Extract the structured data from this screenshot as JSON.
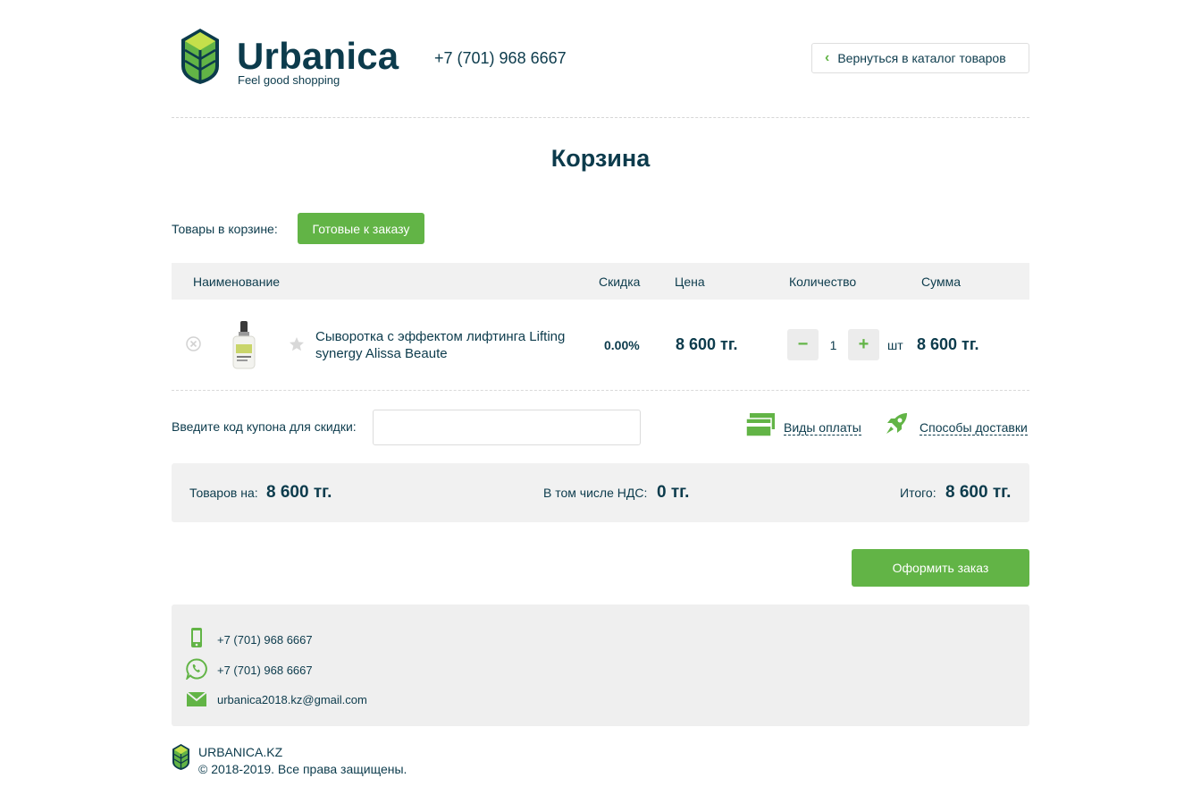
{
  "header": {
    "brand": "Urbanica",
    "tagline": "Feel good shopping",
    "phone": "+7 (701) 968 6667",
    "back_label": "Вернуться в каталог товаров"
  },
  "page_title": "Корзина",
  "cart": {
    "label": "Товары в корзине:",
    "ready_button": "Готовые к заказу",
    "columns": {
      "name": "Наименование",
      "discount": "Скидка",
      "price": "Цена",
      "quantity": "Количество",
      "sum": "Сумма"
    },
    "items": [
      {
        "name": "Сыворотка с эффектом лифтинга Lifting synergy Alissa Beaute",
        "discount": "0.00%",
        "price": "8 600 тг.",
        "quantity": "1",
        "unit": "шт",
        "sum": "8 600 тг."
      }
    ]
  },
  "coupon": {
    "label": "Введите код купона для скидки:",
    "value": ""
  },
  "links": {
    "payment": "Виды оплаты",
    "delivery": "Способы доставки"
  },
  "totals": {
    "goods_label": "Товаров на:",
    "goods_value": "8 600 тг.",
    "vat_label": "В том числе НДС:",
    "vat_value": "0 тг.",
    "total_label": "Итого:",
    "total_value": "8 600 тг."
  },
  "order_button": "Оформить заказ",
  "contacts": {
    "phone": "+7 (701) 968 6667",
    "whatsapp": "+7 (701) 968 6667",
    "email": "urbanica2018.kz@gmail.com"
  },
  "footer": {
    "site": "URBANICA.KZ",
    "copyright": "© 2018-2019. Все права защищены."
  },
  "colors": {
    "accent": "#62b446",
    "text": "#0c3b4c",
    "panel": "#f1f1f1"
  },
  "icons": [
    "logo-icon",
    "chevron-left-icon",
    "remove-icon",
    "star-icon",
    "minus-icon",
    "plus-icon",
    "payment-cards-icon",
    "rocket-icon",
    "phone-icon",
    "whatsapp-icon",
    "mail-icon"
  ]
}
